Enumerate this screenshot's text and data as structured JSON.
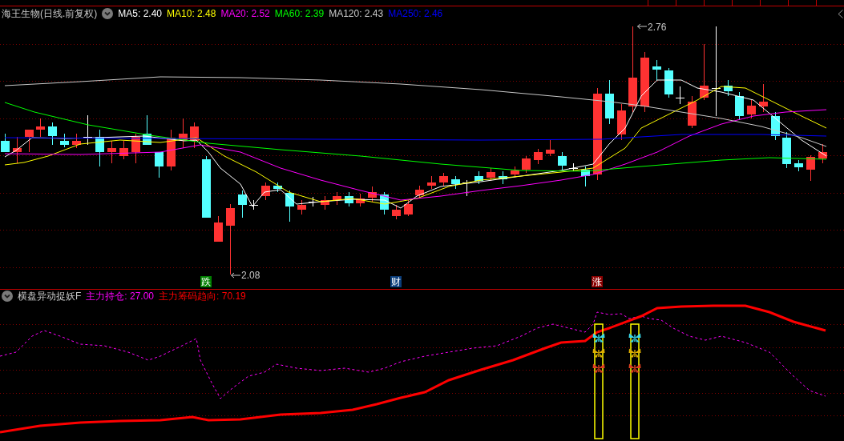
{
  "main_panel": {
    "title": "海王生物(日线.前复权)",
    "indicators": [
      {
        "label": "MA5: 2.40",
        "color": "#ffffff"
      },
      {
        "label": "MA10: 2.48",
        "color": "#ffff00"
      },
      {
        "label": "MA20: 2.52",
        "color": "#ff00ff"
      },
      {
        "label": "MA60: 2.39",
        "color": "#00ff00"
      },
      {
        "label": "MA120: 2.43",
        "color": "#c8c8c8"
      },
      {
        "label": "MA250: 2.46",
        "color": "#0000ff"
      }
    ],
    "high_label": "2.76",
    "low_label": "2.08",
    "event_markers": [
      {
        "text": "跌",
        "color": "#008000"
      },
      {
        "text": "财",
        "color": "#0a3d7a"
      },
      {
        "text": "涨",
        "color": "#8b0000"
      }
    ]
  },
  "indicator_panel": {
    "title": "横盘异动捉妖F",
    "indicators": [
      {
        "label": "主力持仓: 27.00",
        "color": "#ff00ff"
      },
      {
        "label": "主力筹码趋向: 70.19",
        "color": "#ff0000"
      }
    ]
  }
}
